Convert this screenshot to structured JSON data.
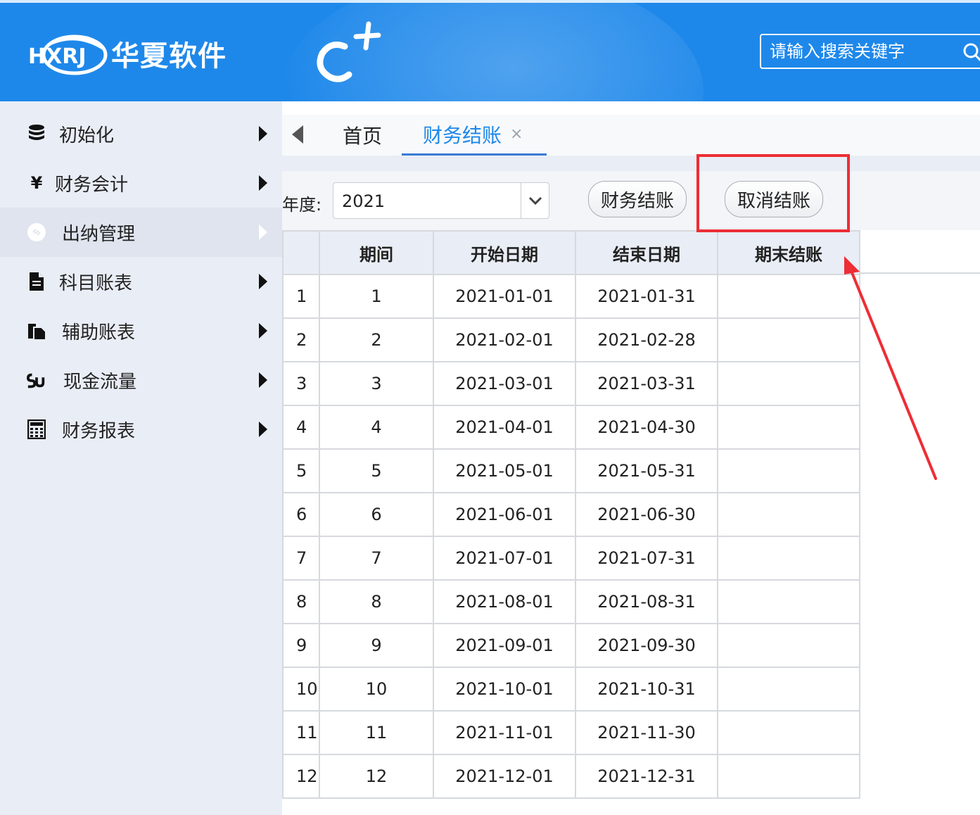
{
  "header": {
    "logo_mark": "HXRJ",
    "logo_text": "华夏软件",
    "product_mark": "C+",
    "search_placeholder": "请输入搜索关键字"
  },
  "sidebar": {
    "items": [
      {
        "label": "初始化",
        "icon": "database-icon"
      },
      {
        "label": "财务会计",
        "icon": "yen-icon"
      },
      {
        "label": "出纳管理",
        "icon": "cashier-icon",
        "active": true
      },
      {
        "label": "科目账表",
        "icon": "document-icon"
      },
      {
        "label": "辅助账表",
        "icon": "copy-document-icon"
      },
      {
        "label": "现金流量",
        "icon": "flow-icon"
      },
      {
        "label": "财务报表",
        "icon": "calculator-icon"
      }
    ]
  },
  "tabs": {
    "home": "首页",
    "active": "财务结账",
    "close": "×"
  },
  "toolbar": {
    "year_label": "年度:",
    "year_value": "2021",
    "close_button": "财务结账",
    "cancel_button": "取消结账"
  },
  "table": {
    "columns": [
      "期间",
      "开始日期",
      "结束日期",
      "期末结账"
    ],
    "rows": [
      {
        "n": "1",
        "period": "1",
        "start": "2021-01-01",
        "end": "2021-01-31",
        "closed": ""
      },
      {
        "n": "2",
        "period": "2",
        "start": "2021-02-01",
        "end": "2021-02-28",
        "closed": ""
      },
      {
        "n": "3",
        "period": "3",
        "start": "2021-03-01",
        "end": "2021-03-31",
        "closed": ""
      },
      {
        "n": "4",
        "period": "4",
        "start": "2021-04-01",
        "end": "2021-04-30",
        "closed": ""
      },
      {
        "n": "5",
        "period": "5",
        "start": "2021-05-01",
        "end": "2021-05-31",
        "closed": ""
      },
      {
        "n": "6",
        "period": "6",
        "start": "2021-06-01",
        "end": "2021-06-30",
        "closed": ""
      },
      {
        "n": "7",
        "period": "7",
        "start": "2021-07-01",
        "end": "2021-07-31",
        "closed": ""
      },
      {
        "n": "8",
        "period": "8",
        "start": "2021-08-01",
        "end": "2021-08-31",
        "closed": ""
      },
      {
        "n": "9",
        "period": "9",
        "start": "2021-09-01",
        "end": "2021-09-30",
        "closed": ""
      },
      {
        "n": "10",
        "period": "10",
        "start": "2021-10-01",
        "end": "2021-10-31",
        "closed": ""
      },
      {
        "n": "11",
        "period": "11",
        "start": "2021-11-01",
        "end": "2021-11-30",
        "closed": ""
      },
      {
        "n": "12",
        "period": "12",
        "start": "2021-12-01",
        "end": "2021-12-31",
        "closed": ""
      }
    ]
  },
  "colors": {
    "header_blue": "#1e88ea",
    "sidebar_bg": "#e9edf5",
    "annotation_red": "#ee2d35",
    "tab_active": "#1e88ea"
  }
}
